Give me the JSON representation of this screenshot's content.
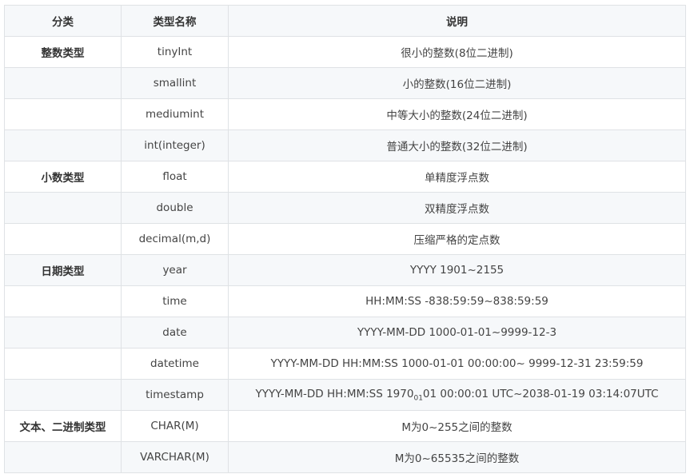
{
  "table": {
    "headers": [
      "分类",
      "类型名称",
      "说明"
    ],
    "rows": [
      {
        "category": "整数类型",
        "name": "tinyInt",
        "desc": "很小的整数(8位二进制)"
      },
      {
        "category": "",
        "name": "smallint",
        "desc": "小的整数(16位二进制)"
      },
      {
        "category": "",
        "name": "mediumint",
        "desc": "中等大小的整数(24位二进制)"
      },
      {
        "category": "",
        "name": "int(integer)",
        "desc": "普通大小的整数(32位二进制)"
      },
      {
        "category": "小数类型",
        "name": "float",
        "desc": "单精度浮点数"
      },
      {
        "category": "",
        "name": "double",
        "desc": "双精度浮点数"
      },
      {
        "category": "",
        "name": "decimal(m,d)",
        "desc": "压缩严格的定点数"
      },
      {
        "category": "日期类型",
        "name": "year",
        "desc": "YYYY 1901~2155"
      },
      {
        "category": "",
        "name": "time",
        "desc": "HH:MM:SS -838:59:59~838:59:59"
      },
      {
        "category": "",
        "name": "date",
        "desc": "YYYY-MM-DD 1000-01-01~9999-12-3"
      },
      {
        "category": "",
        "name": "datetime",
        "desc": "YYYY-MM-DD HH:MM:SS 1000-01-01 00:00:00~ 9999-12-31 23:59:59"
      },
      {
        "category": "",
        "name": "timestamp",
        "desc_parts": {
          "before": "YYYY-MM-DD HH:MM:SS 1970",
          "sub": "01",
          "after": "01 00:00:01 UTC~2038-01-19 03:14:07UTC"
        }
      },
      {
        "category": "文本、二进制类型",
        "name": "CHAR(M)",
        "desc": "M为0~255之间的整数"
      },
      {
        "category": "",
        "name": "VARCHAR(M)",
        "desc": "M为0~65535之间的整数"
      }
    ]
  }
}
